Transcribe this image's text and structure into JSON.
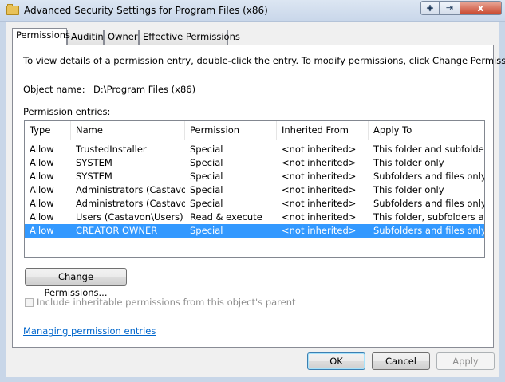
{
  "window": {
    "title": "Advanced Security Settings for Program Files (x86)",
    "controls": {
      "help_icon": "nav-diamond-icon",
      "mid_icon": "window-icon",
      "close_label": "x"
    }
  },
  "tabs": [
    {
      "label": "Permissions",
      "active": true
    },
    {
      "label": "Auditing",
      "active": false
    },
    {
      "label": "Owner",
      "active": false
    },
    {
      "label": "Effective Permissions",
      "active": false
    }
  ],
  "permissions": {
    "instruction": "To view details of a permission entry, double-click the entry. To modify permissions, click Change Permissions.",
    "object_name_label": "Object name:",
    "object_name_value": "D:\\Program Files (x86)",
    "entries_label": "Permission entries:",
    "columns": [
      "Type",
      "Name",
      "Permission",
      "Inherited From",
      "Apply To"
    ],
    "rows": [
      {
        "type": "Allow",
        "name": "TrustedInstaller",
        "permission": "Special",
        "inherited": "<not inherited>",
        "apply_to": "This folder and subfolders",
        "selected": false
      },
      {
        "type": "Allow",
        "name": "SYSTEM",
        "permission": "Special",
        "inherited": "<not inherited>",
        "apply_to": "This folder only",
        "selected": false
      },
      {
        "type": "Allow",
        "name": "SYSTEM",
        "permission": "Special",
        "inherited": "<not inherited>",
        "apply_to": "Subfolders and files only",
        "selected": false
      },
      {
        "type": "Allow",
        "name": "Administrators (Castavon\\...",
        "permission": "Special",
        "inherited": "<not inherited>",
        "apply_to": "This folder only",
        "selected": false
      },
      {
        "type": "Allow",
        "name": "Administrators (Castavon\\...",
        "permission": "Special",
        "inherited": "<not inherited>",
        "apply_to": "Subfolders and files only",
        "selected": false
      },
      {
        "type": "Allow",
        "name": "Users (Castavon\\Users)",
        "permission": "Read & execute",
        "inherited": "<not inherited>",
        "apply_to": "This folder, subfolders and...",
        "selected": false
      },
      {
        "type": "Allow",
        "name": "CREATOR OWNER",
        "permission": "Special",
        "inherited": "<not inherited>",
        "apply_to": "Subfolders and files only",
        "selected": true
      }
    ],
    "change_button": "Change Permissions...",
    "inherit_checkbox": {
      "label": "Include inheritable permissions from this object's parent",
      "checked": false,
      "enabled": false
    },
    "link": "Managing permission entries"
  },
  "footer": {
    "ok": "OK",
    "cancel": "Cancel",
    "apply": "Apply"
  },
  "colors": {
    "selection": "#3399ff",
    "link": "#0066cc",
    "disabled_text": "#8d8d8d"
  }
}
